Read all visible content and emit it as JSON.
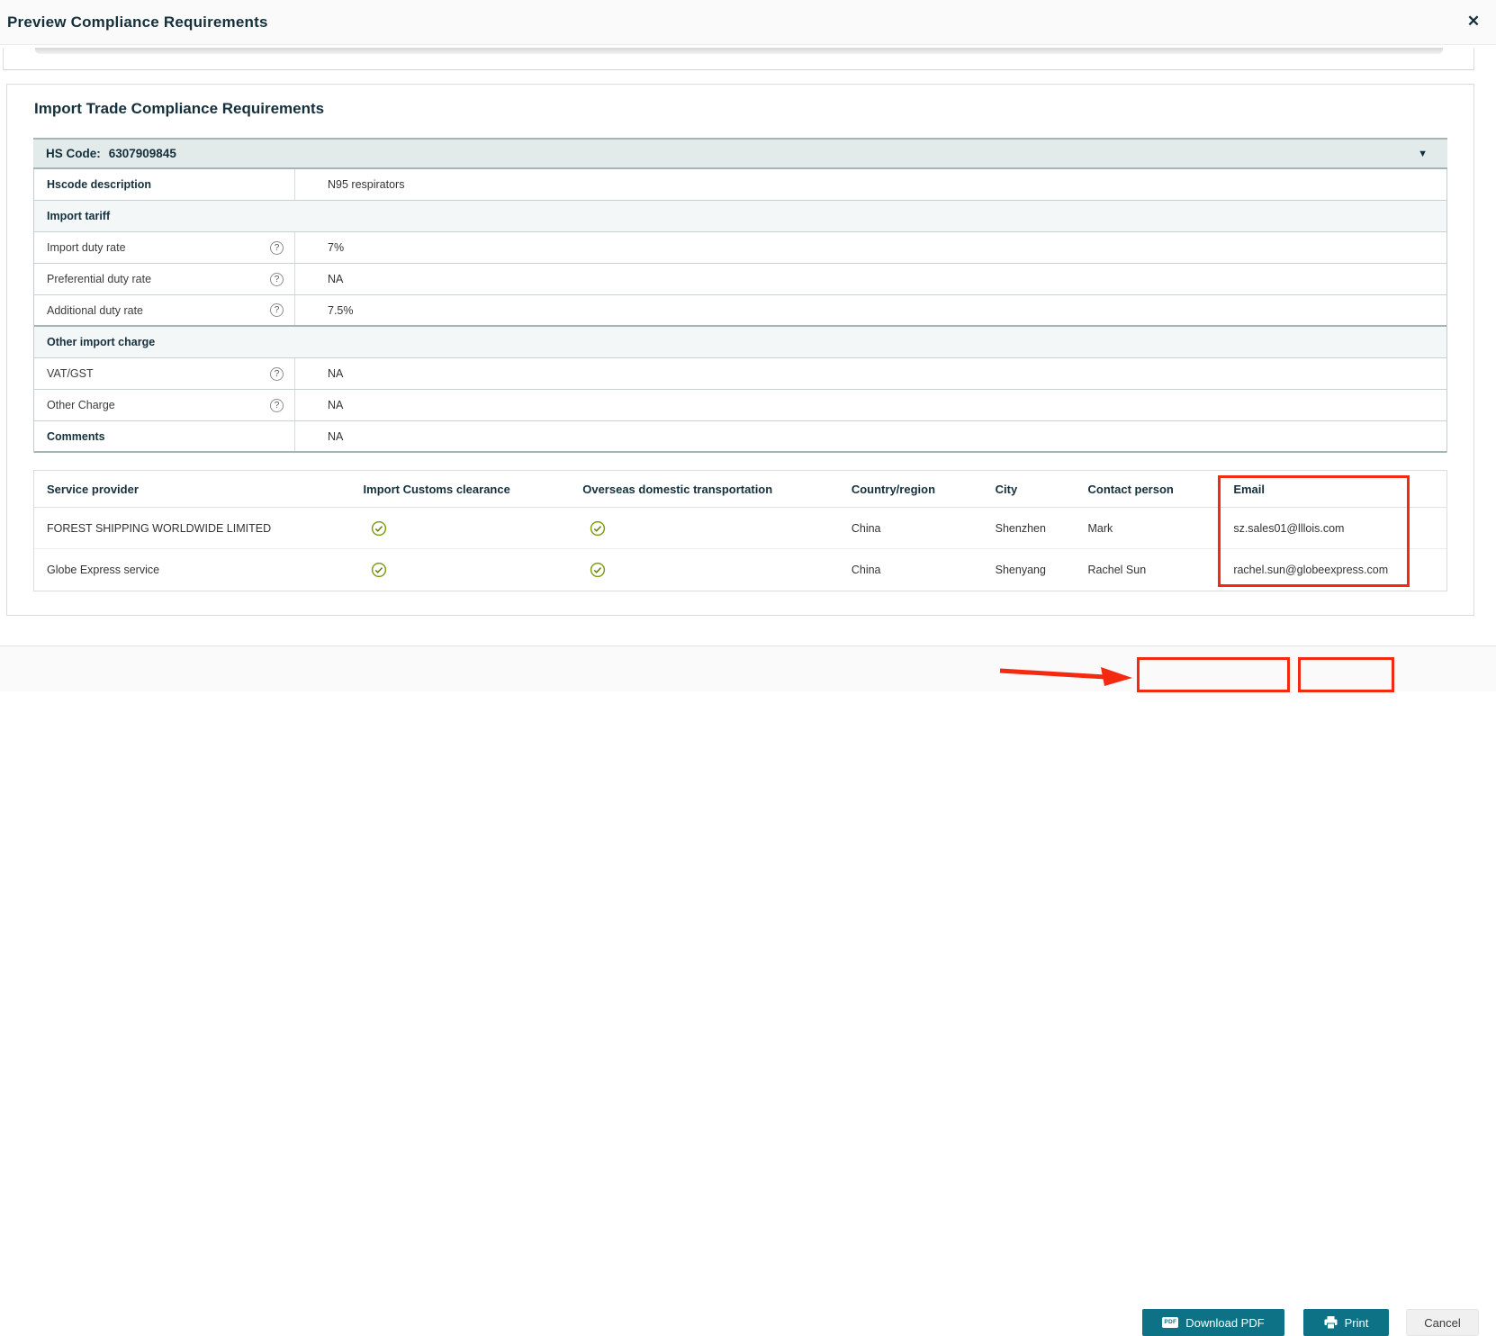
{
  "modal": {
    "title": "Preview Compliance Requirements"
  },
  "icons": {
    "close": "✕",
    "collapse": "▼",
    "help": "?",
    "pdf_badge": "PDF"
  },
  "section": {
    "title": "Import Trade Compliance Requirements"
  },
  "hs_panel": {
    "label": "HS Code:",
    "code": "6307909845",
    "detail_rows": [
      {
        "type": "kv",
        "label": "Hscode description",
        "value": "N95 respirators",
        "bold": true,
        "help": false
      },
      {
        "type": "section",
        "label": "Import tariff"
      },
      {
        "type": "kv",
        "label": "Import duty rate",
        "value": "7%",
        "bold": false,
        "help": true
      },
      {
        "type": "kv",
        "label": "Preferential duty rate",
        "value": "NA",
        "bold": false,
        "help": true
      },
      {
        "type": "kv",
        "label": "Additional duty rate",
        "value": "7.5%",
        "bold": false,
        "help": true,
        "thick_bottom": true
      },
      {
        "type": "section",
        "label": "Other import charge"
      },
      {
        "type": "kv",
        "label": "VAT/GST",
        "value": "NA",
        "bold": false,
        "help": true
      },
      {
        "type": "kv",
        "label": "Other Charge",
        "value": "NA",
        "bold": false,
        "help": true
      },
      {
        "type": "kv",
        "label": "Comments",
        "value": "NA",
        "bold": true,
        "help": false
      }
    ]
  },
  "provider_table": {
    "columns": [
      "Service provider",
      "Import Customs clearance",
      "Overseas domestic transportation",
      "Country/region",
      "City",
      "Contact person",
      "Email"
    ],
    "rows": [
      {
        "service_provider": "FOREST SHIPPING WORLDWIDE LIMITED",
        "import_customs_clearance": "check",
        "overseas_domestic_transportation": "check",
        "country_region": "China",
        "city": "Shenzhen",
        "contact_person": "Mark",
        "email": "sz.sales01@lllois.com"
      },
      {
        "service_provider": "Globe Express service",
        "import_customs_clearance": "check",
        "overseas_domestic_transportation": "check",
        "country_region": "China",
        "city": "Shenyang",
        "contact_person": "Rachel Sun",
        "email": "rachel.sun@globeexpress.com"
      }
    ]
  },
  "footer": {
    "download_label": "Download PDF",
    "print_label": "Print",
    "cancel_label": "Cancel"
  },
  "colors": {
    "accent_teal": "#0d7285",
    "annotation_red": "#f42a10",
    "check_green": "#7f9d15",
    "header_navy": "#14303c"
  }
}
